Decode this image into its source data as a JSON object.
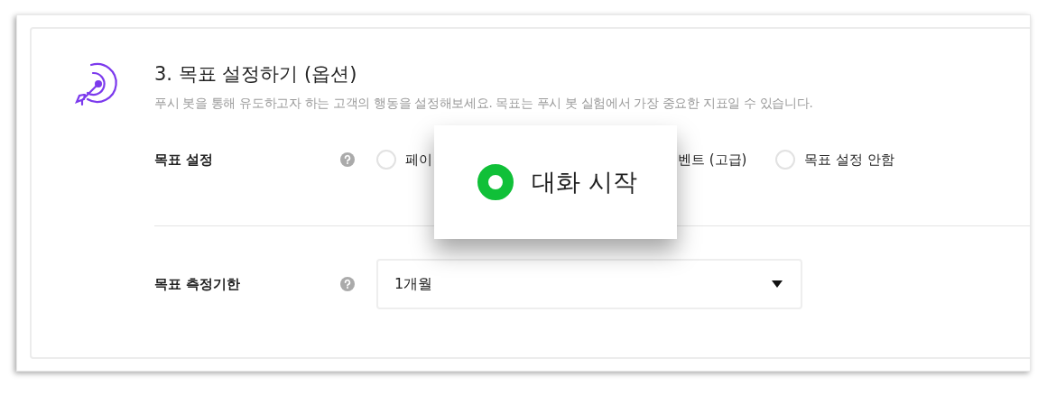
{
  "section": {
    "title": "3. 목표 설정하기 (옵션)",
    "description": "푸시 봇을 통해 유도하고자 하는 고객의 행동을 설정해보세요. 목표는 푸시 봇 실험에서 가장 중요한 지표일 수 있습니다."
  },
  "goal_row": {
    "label": "목표 설정",
    "options": [
      {
        "kind": "option",
        "label": "페이",
        "selected": false
      },
      {
        "kind": "partial",
        "label": "벤트 (고급)"
      },
      {
        "kind": "option",
        "label": "목표 설정 안함",
        "selected": false
      }
    ]
  },
  "period_row": {
    "label": "목표 측정기한",
    "value": "1개월"
  },
  "callout": {
    "label": "대화 시작",
    "selected": true
  }
}
